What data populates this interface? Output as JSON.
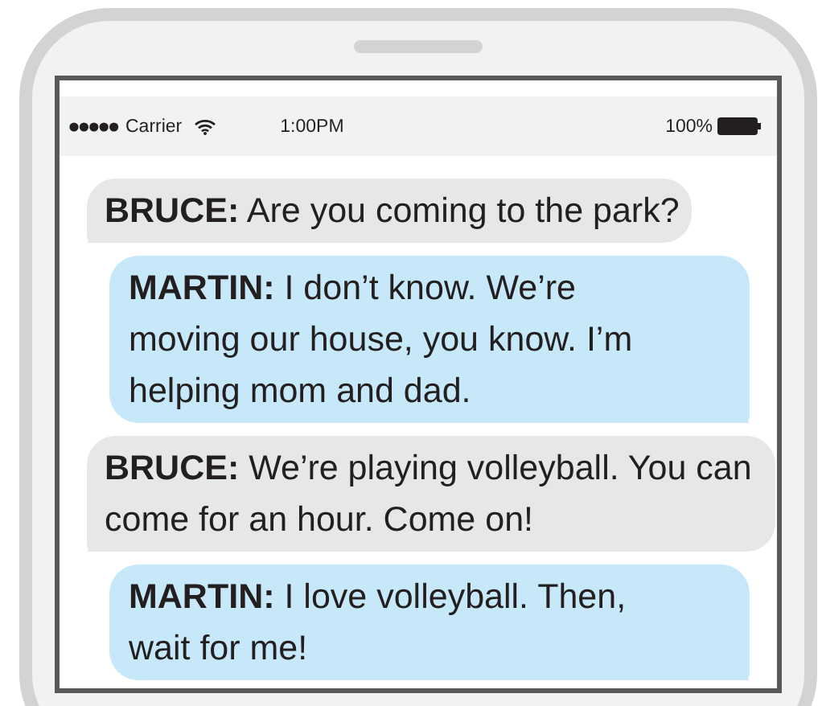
{
  "status_bar": {
    "carrier": "Carrier",
    "time": "1:00PM",
    "battery": "100%"
  },
  "messages": [
    {
      "kind": "received",
      "text": "**BRUCE:** Are you coming to the park?"
    },
    {
      "kind": "sent",
      "text": "**MARTIN:** I don’t know. We’re moving our house, you know. I’m helping mom and dad."
    },
    {
      "kind": "received",
      "text": "**BRUCE:** We’re playing volleyball. You can come for an hour. Come on!"
    },
    {
      "kind": "sent",
      "text": "**MARTIN:** I love volleyball. Then, wait for me!"
    }
  ]
}
